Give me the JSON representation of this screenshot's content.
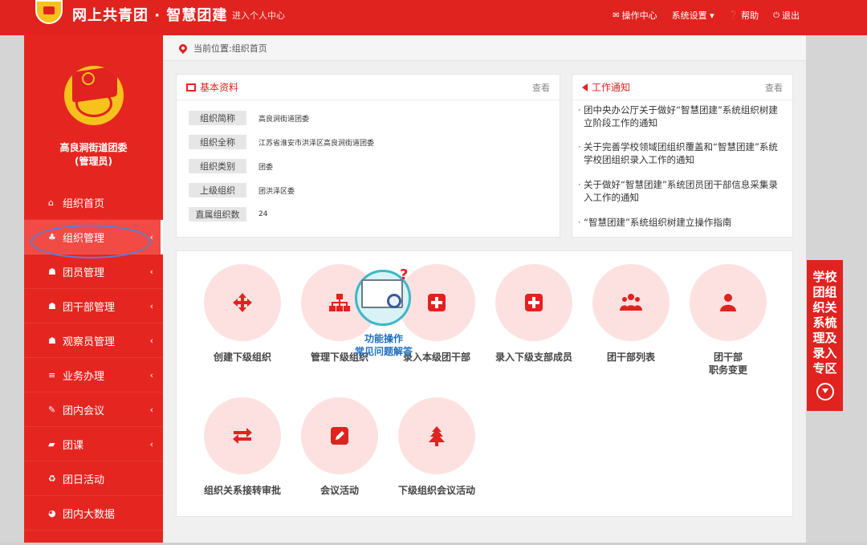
{
  "header": {
    "brand": "网上共青团 · 智慧团建",
    "enter_personal": "进入个人中心",
    "nav": [
      {
        "icon": "envelope-icon",
        "label": "操作中心"
      },
      {
        "icon": "",
        "label": "系统设置 ▾"
      },
      {
        "icon": "help-icon",
        "label": "帮助"
      },
      {
        "icon": "power-icon",
        "label": "退出"
      }
    ]
  },
  "sidebar": {
    "org_name_line1": "高良涧街道团委",
    "org_name_line2": "(管理员)",
    "items": [
      {
        "icon": "home-icon",
        "label": "组织首页",
        "has_chevron": false
      },
      {
        "icon": "org-tree-icon",
        "label": "组织管理",
        "has_chevron": true,
        "active": true
      },
      {
        "icon": "users-icon",
        "label": "团员管理",
        "has_chevron": true
      },
      {
        "icon": "users-icon",
        "label": "团干部管理",
        "has_chevron": true
      },
      {
        "icon": "users-icon",
        "label": "观察员管理",
        "has_chevron": true
      },
      {
        "icon": "list-icon",
        "label": "业务办理",
        "has_chevron": true
      },
      {
        "icon": "edit-icon",
        "label": "团内会议",
        "has_chevron": true
      },
      {
        "icon": "folder-icon",
        "label": "团课",
        "has_chevron": true
      },
      {
        "icon": "recycle-icon",
        "label": "团日活动",
        "has_chevron": false
      },
      {
        "icon": "pie-icon",
        "label": "团内大数据",
        "has_chevron": false
      }
    ]
  },
  "breadcrumb": {
    "text": "当前位置:组织首页"
  },
  "basic_info": {
    "title": "基本资料",
    "more": "查看",
    "rows": [
      {
        "label": "组织简称",
        "value": "高良涧街道团委"
      },
      {
        "label": "组织全称",
        "value": "江苏省淮安市洪泽区高良涧街道团委"
      },
      {
        "label": "组织类别",
        "value": "团委"
      },
      {
        "label": "上级组织",
        "value": "团洪泽区委"
      },
      {
        "label": "直属组织数",
        "value": "24"
      }
    ]
  },
  "notices": {
    "title": "工作通知",
    "more": "查看",
    "items": [
      "团中央办公厅关于做好“智慧团建”系统组织树建立阶段工作的通知",
      "关于完善学校领域团组织覆盖和“智慧团建”系统学校团组织录入工作的通知",
      "关于做好“智慧团建”系统团员团干部信息采集录入工作的通知",
      "“智慧团建”系统组织树建立操作指南"
    ]
  },
  "functions": [
    {
      "icon": "move-arrows-icon",
      "label": "创建下级组织"
    },
    {
      "icon": "org-tree-icon",
      "label": "管理下级组织"
    },
    {
      "icon": "plus-square-icon",
      "label": "录入本级团干部"
    },
    {
      "icon": "plus-square-icon",
      "label": "录入下级支部成员"
    },
    {
      "icon": "group-icon",
      "label": "团干部列表"
    },
    {
      "icon": "user-icon",
      "label": "团干部\n职务变更"
    },
    {
      "icon": "transfer-icon",
      "label": "组织关系接转审批"
    },
    {
      "icon": "edit-icon",
      "label": "会议活动"
    },
    {
      "icon": "tree-icon",
      "label": "下级组织会议活动"
    }
  ],
  "help_widget": {
    "line1": "功能操作",
    "line2": "常见问题解答"
  },
  "side_banner": {
    "text": "学校团组织关系梳理及录入专区"
  },
  "colors": {
    "primary": "#e0231f",
    "sidebar": "#e52620",
    "circle": "#fde1e1",
    "highlight": "#5b7fd4"
  }
}
